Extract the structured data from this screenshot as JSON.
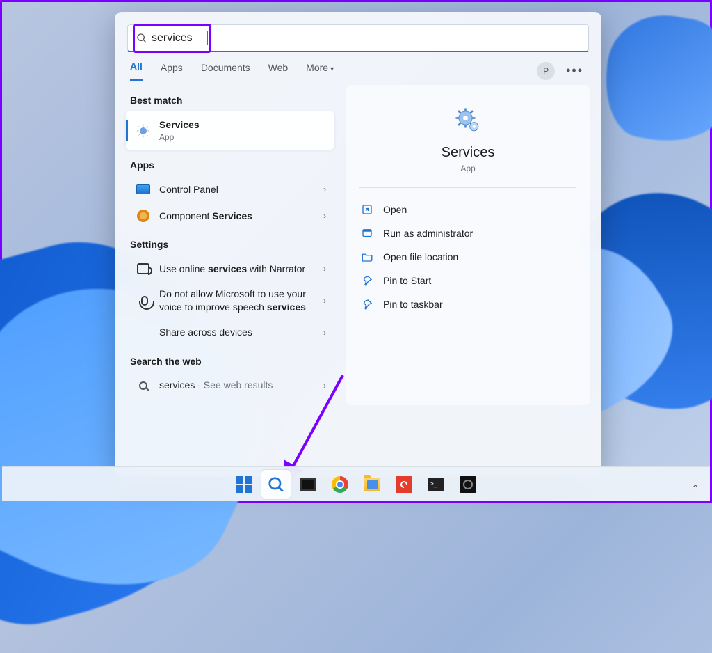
{
  "search": {
    "query": "services",
    "icon": "search-icon"
  },
  "tabs": {
    "items": [
      "All",
      "Apps",
      "Documents",
      "Web",
      "More"
    ],
    "active": "All",
    "account_initial": "P"
  },
  "sections": {
    "best_match": {
      "label": "Best match",
      "title": "Services",
      "subtitle": "App"
    },
    "apps": {
      "label": "Apps",
      "items": [
        {
          "title": "Control Panel"
        },
        {
          "title_prefix": "Component ",
          "title_bold": "Services"
        }
      ]
    },
    "settings": {
      "label": "Settings",
      "items": [
        {
          "pre": "Use online ",
          "bold": "services",
          "post": " with Narrator"
        },
        {
          "pre": "Do not allow Microsoft to use your voice to improve speech ",
          "bold": "services",
          "post": ""
        },
        {
          "pre": "Share across devices",
          "bold": "",
          "post": ""
        }
      ]
    },
    "web": {
      "label": "Search the web",
      "query": "services",
      "hint": " - See web results"
    }
  },
  "preview": {
    "title": "Services",
    "subtitle": "App",
    "actions": [
      {
        "icon": "open-icon",
        "label": "Open"
      },
      {
        "icon": "shield-icon",
        "label": "Run as administrator"
      },
      {
        "icon": "folder-icon",
        "label": "Open file location"
      },
      {
        "icon": "pin-icon",
        "label": "Pin to Start"
      },
      {
        "icon": "pin-icon",
        "label": "Pin to taskbar"
      }
    ]
  },
  "taskbar": {
    "items": [
      {
        "name": "start",
        "active": false
      },
      {
        "name": "search",
        "active": true
      },
      {
        "name": "task-view",
        "active": false
      },
      {
        "name": "chrome",
        "active": false
      },
      {
        "name": "file-explorer",
        "active": false
      },
      {
        "name": "snip",
        "active": false
      },
      {
        "name": "terminal",
        "active": false
      },
      {
        "name": "obs",
        "active": false
      }
    ],
    "tray_chevron": "⌃"
  }
}
